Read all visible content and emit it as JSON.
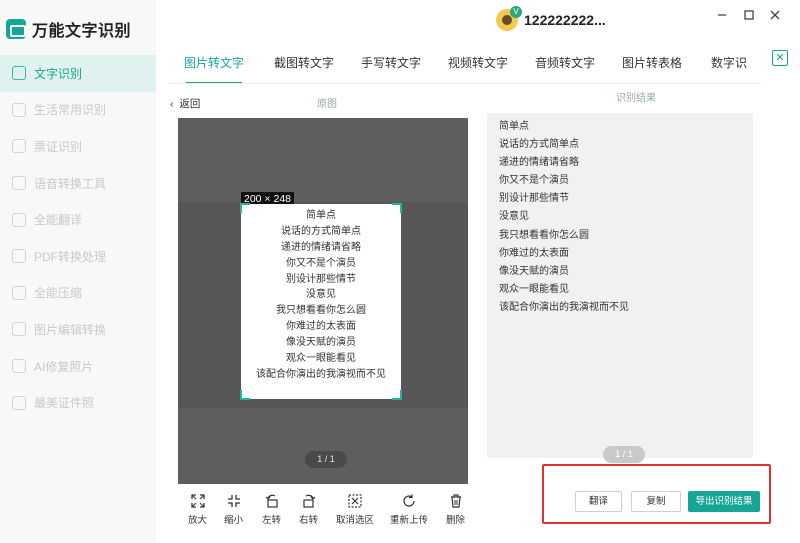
{
  "app": {
    "name": "万能文字识别",
    "accent_color": "#17a596"
  },
  "user": {
    "name": "122222222...",
    "badge": "V"
  },
  "window_controls": [
    "minimize-icon",
    "maximize-icon",
    "close-icon"
  ],
  "sidebar": {
    "items": [
      {
        "label": "文字识别",
        "active": true
      },
      {
        "label": "生活常用识别",
        "active": false
      },
      {
        "label": "票证识别",
        "active": false
      },
      {
        "label": "语音转换工具",
        "active": false
      },
      {
        "label": "全能翻译",
        "active": false
      },
      {
        "label": "PDF转换处理",
        "active": false
      },
      {
        "label": "全能压缩",
        "active": false
      },
      {
        "label": "图片编辑转换",
        "active": false
      },
      {
        "label": "AI修复照片",
        "active": false
      },
      {
        "label": "最美证件照",
        "active": false
      }
    ]
  },
  "tabs": [
    {
      "label": "图片转文字",
      "active": true
    },
    {
      "label": "截图转文字",
      "active": false
    },
    {
      "label": "手写转文字",
      "active": false
    },
    {
      "label": "视频转文字",
      "active": false
    },
    {
      "label": "音频转文字",
      "active": false
    },
    {
      "label": "图片转表格",
      "active": false
    },
    {
      "label": "数字识",
      "active": false
    }
  ],
  "subheader": {
    "back": "返回",
    "original_label": "原图",
    "result_label": "识别结果"
  },
  "original": {
    "size_badge": "200 × 248",
    "lines": [
      "简单点",
      "说话的方式简单点",
      "递进的情绪请省略",
      "你又不是个演员",
      "别设计那些情节",
      "没意见",
      "我只想看看你怎么圆",
      "你难过的太表面",
      "像没天赋的演员",
      "观众一眼能看见",
      "该配合你演出的我演视而不见"
    ],
    "pager": "1 / 1"
  },
  "toolbar": [
    {
      "label": "放大",
      "icon": "expand-icon"
    },
    {
      "label": "缩小",
      "icon": "shrink-icon"
    },
    {
      "label": "左转",
      "icon": "rotate-left-icon"
    },
    {
      "label": "右转",
      "icon": "rotate-right-icon"
    },
    {
      "label": "取消选区",
      "icon": "deselect-icon"
    },
    {
      "label": "重新上传",
      "icon": "reupload-icon"
    },
    {
      "label": "删除",
      "icon": "trash-icon"
    }
  ],
  "result": {
    "lines": [
      "简单点",
      "说话的方式简单点",
      "递进的情绪请省略",
      "你又不是个演员",
      "别设计那些情节",
      "没意见",
      "我只想看看你怎么圆",
      "你难过的太表面",
      "像没天赋的演员",
      "观众一眼能看见",
      "该配合你演出的我演视而不见"
    ],
    "pager": "1 / 1"
  },
  "actions": {
    "translate": "翻译",
    "copy": "复制",
    "export": "导出识别结果"
  }
}
